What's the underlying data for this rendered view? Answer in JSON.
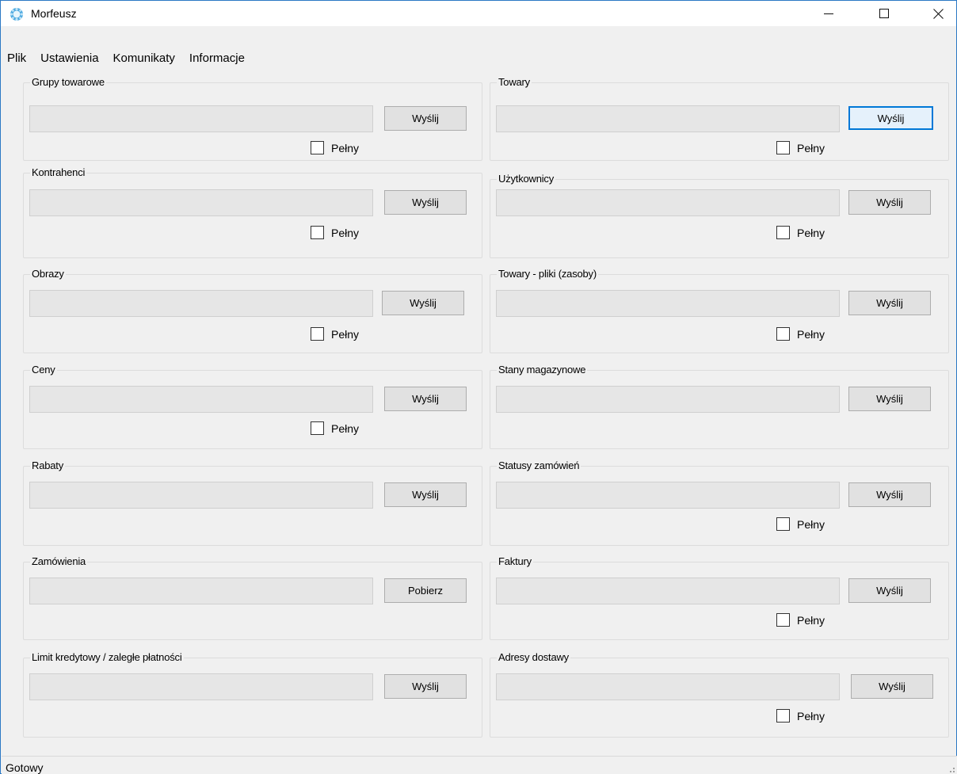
{
  "window": {
    "title": "Morfeusz",
    "minimize_glyph": "—",
    "maximize_glyph": "☐",
    "close_glyph": "✕"
  },
  "menu": {
    "items": [
      "Plik",
      "Ustawienia",
      "Komunikaty",
      "Informacje"
    ]
  },
  "groups": {
    "left": [
      {
        "title": "Grupy towarowe",
        "button": "Wyślij",
        "checkbox": "Pełny"
      },
      {
        "title": "Kontrahenci",
        "button": "Wyślij",
        "checkbox": "Pełny"
      },
      {
        "title": "Obrazy",
        "button": "Wyślij",
        "checkbox": "Pełny"
      },
      {
        "title": "Ceny",
        "button": "Wyślij",
        "checkbox": "Pełny"
      },
      {
        "title": "Rabaty",
        "button": "Wyślij"
      },
      {
        "title": "Zamówienia",
        "button": "Pobierz"
      },
      {
        "title": "Limit kredytowy / zaległe płatności",
        "button": "Wyślij"
      }
    ],
    "right": [
      {
        "title": "Towary",
        "button": "Wyślij",
        "checkbox": "Pełny"
      },
      {
        "title": "Użytkownicy",
        "button": "Wyślij",
        "checkbox": "Pełny"
      },
      {
        "title": "Towary - pliki (zasoby)",
        "button": "Wyślij",
        "checkbox": "Pełny"
      },
      {
        "title": "Stany magazynowe",
        "button": "Wyślij"
      },
      {
        "title": "Statusy zamówień",
        "button": "Wyślij",
        "checkbox": "Pełny"
      },
      {
        "title": "Faktury",
        "button": "Wyślij",
        "checkbox": "Pełny"
      },
      {
        "title": "Adresy dostawy",
        "button": "Wyślij",
        "checkbox": "Pełny"
      }
    ]
  },
  "status": {
    "text": "Gotowy"
  },
  "colors": {
    "window_border": "#2b78c5",
    "focus_accent": "#0078d7",
    "background": "#f0f0f0"
  }
}
